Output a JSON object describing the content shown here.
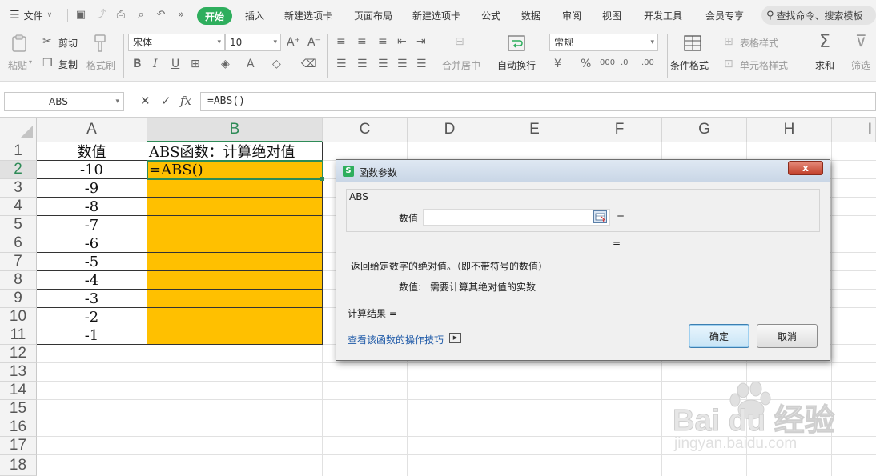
{
  "menubar": {
    "file_label": "文件",
    "tabs": [
      "开始",
      "插入",
      "新建选项卡",
      "页面布局",
      "新建选项卡",
      "公式",
      "数据",
      "审阅",
      "视图",
      "开发工具",
      "会员专享"
    ],
    "search_label": "查找命令、搜索模板"
  },
  "ribbon": {
    "paste_label": "粘贴",
    "cut_label": "剪切",
    "copy_label": "复制",
    "format_painter_label": "格式刷",
    "font_name": "宋体",
    "font_size": "10",
    "merge_center_label": "合并居中",
    "wrap_text_label": "自动换行",
    "number_format": "常规",
    "conditional_format_label": "条件格式",
    "table_style_label": "表格样式",
    "cell_style_label": "单元格样式",
    "sum_label": "求和",
    "filter_label": "筛选"
  },
  "formula_bar": {
    "name_box": "ABS",
    "formula": "=ABS()"
  },
  "sheet": {
    "columns": [
      "A",
      "B",
      "C",
      "D",
      "E",
      "F",
      "G",
      "H",
      "I"
    ],
    "rows": [
      "1",
      "2",
      "3",
      "4",
      "5",
      "6",
      "7",
      "8",
      "9",
      "10",
      "11",
      "12",
      "13",
      "14",
      "15",
      "16",
      "17",
      "18"
    ],
    "header_a": "数值",
    "header_b": "ABS函数：计算绝对值",
    "values_a": [
      "-10",
      "-9",
      "-8",
      "-7",
      "-6",
      "-5",
      "-4",
      "-3",
      "-2",
      "-1"
    ],
    "b2_formula": "=ABS()",
    "fill_color": "#ffc000",
    "accent_color": "#2e8b57"
  },
  "dialog": {
    "title": "函数参数",
    "logo": "S",
    "close": "x",
    "function_name": "ABS",
    "param_label": "数值",
    "eq1": "=",
    "eq2": "=",
    "description": "返回给定数字的绝对值。（即不带符号的数值）",
    "param_desc_label": "数值:",
    "param_desc": "需要计算其绝对值的实数",
    "result_label": "计算结果  =",
    "help_link": "查看该函数的操作技巧",
    "ok_label": "确定",
    "cancel_label": "取消"
  },
  "watermark": {
    "logo_text": "Baidu经验",
    "url": "jingyan.baidu.com"
  }
}
